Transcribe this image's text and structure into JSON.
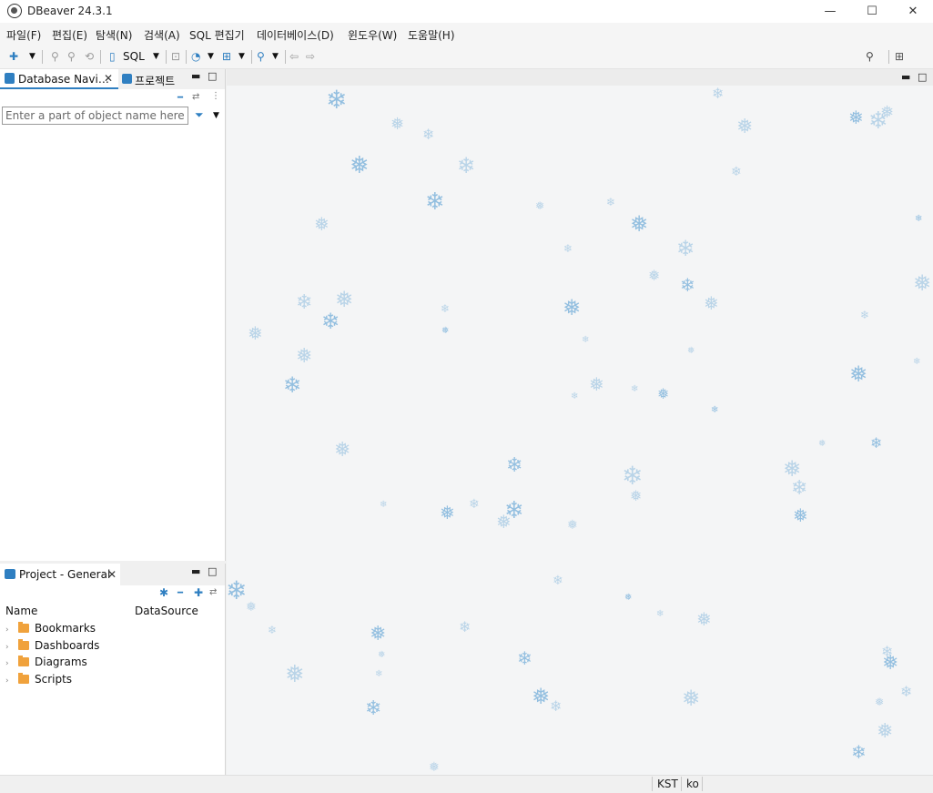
{
  "window": {
    "title": "DBeaver 24.3.1",
    "controls": {
      "minimize": "—",
      "maximize": "☐",
      "close": "✕"
    }
  },
  "menu": {
    "items": [
      {
        "label": "파일(F)"
      },
      {
        "label": "편집(E)"
      },
      {
        "label": "탐색(N)"
      },
      {
        "label": "검색(A)"
      },
      {
        "label": "SQL 편집기"
      },
      {
        "label": "데이터베이스(D)"
      },
      {
        "label": "윈도우(W)"
      },
      {
        "label": "도움말(H)"
      }
    ]
  },
  "toolbar": {
    "sql_label": "SQL",
    "icons": [
      "new-connection-icon",
      "connect-icon",
      "disconnect-icon",
      "invalidate-icon",
      "sql-editor-icon",
      "lock-icon",
      "dashboard-icon",
      "commit-icon",
      "search-icon",
      "back-icon",
      "forward-icon",
      "global-search-icon",
      "perspective-icon",
      "dbeaver-perspective-icon"
    ]
  },
  "navigator": {
    "tabs": [
      {
        "label": "Database Navi…",
        "active": true
      },
      {
        "label": "프로젝트",
        "active": false
      }
    ],
    "filter": {
      "placeholder": "Enter a part of object name here",
      "value": ""
    }
  },
  "project": {
    "tab_label": "Project - General",
    "columns": [
      "Name",
      "DataSource"
    ],
    "items": [
      {
        "label": "Bookmarks"
      },
      {
        "label": "Dashboards"
      },
      {
        "label": "Diagrams"
      },
      {
        "label": "Scripts"
      }
    ]
  },
  "statusbar": {
    "timezone": "KST",
    "locale": "ko"
  },
  "colors": {
    "accent": "#2f7fc1",
    "folder": "#f0a23c",
    "snowflake": "#b9d4e8"
  }
}
